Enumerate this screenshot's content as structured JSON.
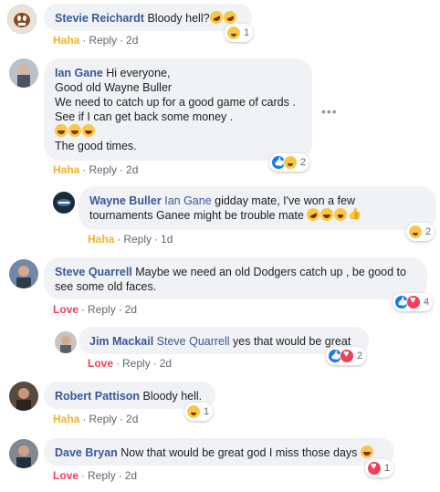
{
  "colors": {
    "author": "#385898",
    "haha": "#f7b125",
    "love": "#f33e58",
    "bubble": "#f0f2f5"
  },
  "comments": [
    {
      "author": "Stevie Reichardt",
      "text": "Bloody hell?",
      "reaction": "Haha",
      "reply": "Reply",
      "time": "2d",
      "reaction_count": "1"
    },
    {
      "author": "Ian Gane",
      "lines": [
        "Hi everyone,",
        "Good old Wayne Buller",
        "We need to catch up for a good game of cards .",
        "See if I can get back some money ."
      ],
      "last_line": "The good times.",
      "reaction": "Haha",
      "reply": "Reply",
      "time": "2d",
      "reaction_count": "2",
      "more": "•••"
    },
    {
      "author": "Wayne Buller",
      "mention": "Ian Gane",
      "text": " gidday mate, I've won a few",
      "text2": "tournaments Ganee might be trouble mate ",
      "reaction": "Haha",
      "reply": "Reply",
      "time": "1d",
      "reaction_count": "2"
    },
    {
      "author": "Steve Quarrell",
      "text": " Maybe we need an old Dodgers catch up , be good to",
      "text2": "see some old faces.",
      "reaction": "Love",
      "reply": "Reply",
      "time": "2d",
      "reaction_count": "4"
    },
    {
      "author": "Jim Mackail",
      "mention": "Steve Quarrell",
      "text": " yes that would be great",
      "reaction": "Love",
      "reply": "Reply",
      "time": "2d",
      "reaction_count": "2"
    },
    {
      "author": "Robert Pattison",
      "text": " Bloody hell.",
      "reaction": "Haha",
      "reply": "Reply",
      "time": "2d",
      "reaction_count": "1"
    },
    {
      "author": "Dave Bryan",
      "text": " Now that would be great god I miss those days ",
      "reaction": "Love",
      "reply": "Reply",
      "time": "2d",
      "reaction_count": "1"
    }
  ]
}
